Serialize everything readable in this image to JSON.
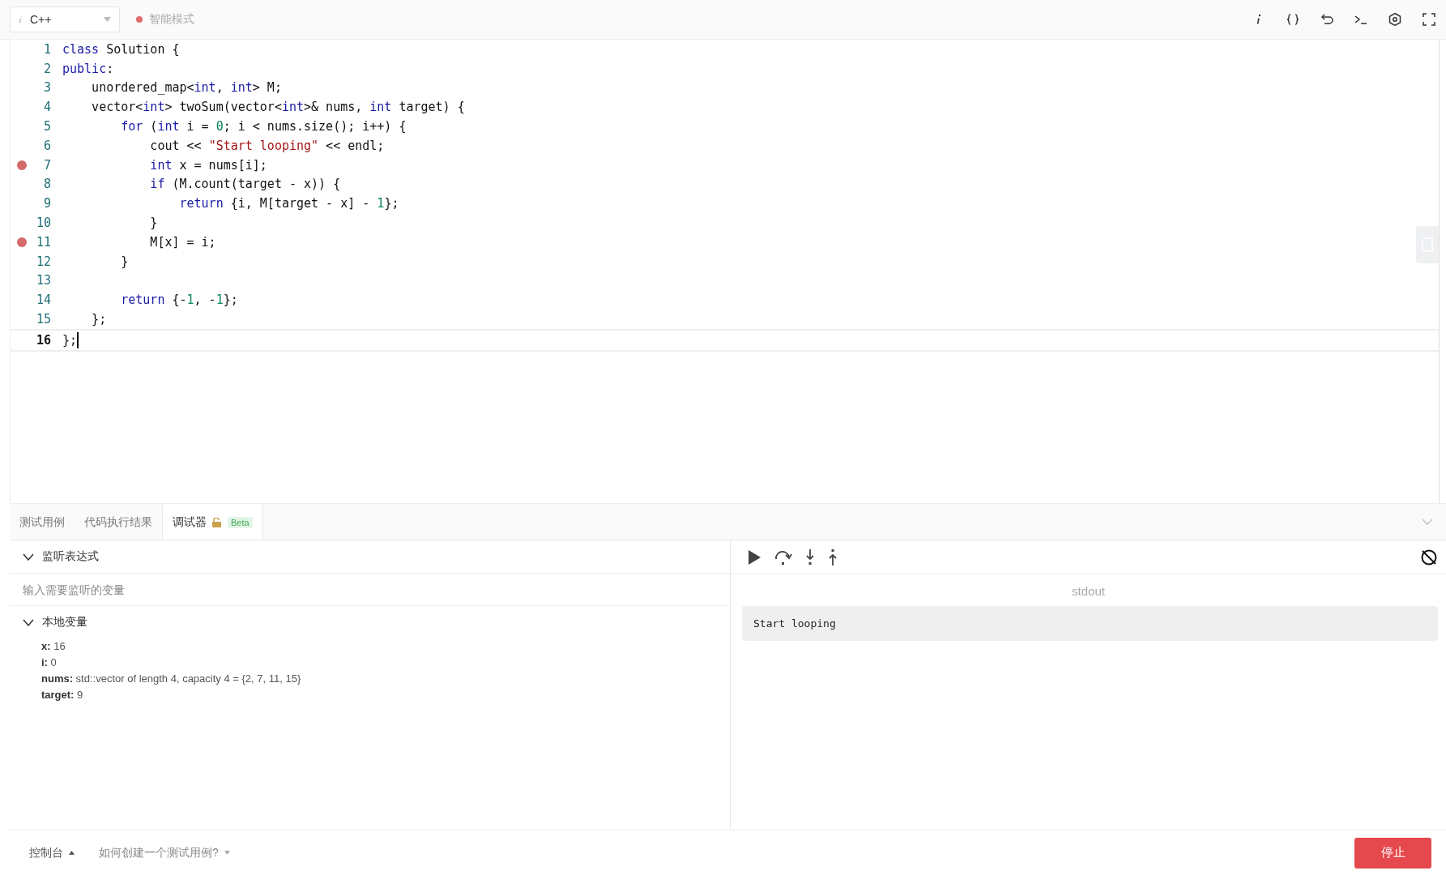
{
  "toolbar": {
    "language": "C++",
    "mode": {
      "label": "智能模式",
      "color": "#e06c6c"
    }
  },
  "editor": {
    "lines": [
      {
        "number": "1",
        "breakpoint": false,
        "current": false,
        "tokens": [
          {
            "kind": "kw",
            "text": "class"
          },
          {
            "kind": "plain",
            "text": " Solution {"
          }
        ]
      },
      {
        "number": "2",
        "breakpoint": false,
        "current": false,
        "tokens": [
          {
            "kind": "kw",
            "text": "public"
          },
          {
            "kind": "plain",
            "text": ":"
          }
        ]
      },
      {
        "number": "3",
        "breakpoint": false,
        "current": false,
        "tokens": [
          {
            "kind": "plain",
            "text": "    unordered_map<"
          },
          {
            "kind": "kw",
            "text": "int"
          },
          {
            "kind": "plain",
            "text": ", "
          },
          {
            "kind": "kw",
            "text": "int"
          },
          {
            "kind": "plain",
            "text": "> M;"
          }
        ]
      },
      {
        "number": "4",
        "breakpoint": false,
        "current": false,
        "tokens": [
          {
            "kind": "plain",
            "text": "    vector<"
          },
          {
            "kind": "kw",
            "text": "int"
          },
          {
            "kind": "plain",
            "text": "> twoSum(vector<"
          },
          {
            "kind": "kw",
            "text": "int"
          },
          {
            "kind": "plain",
            "text": ">& nums, "
          },
          {
            "kind": "kw",
            "text": "int"
          },
          {
            "kind": "plain",
            "text": " target) {"
          }
        ]
      },
      {
        "number": "5",
        "breakpoint": false,
        "current": false,
        "tokens": [
          {
            "kind": "kw",
            "text": "        for"
          },
          {
            "kind": "plain",
            "text": " ("
          },
          {
            "kind": "kw",
            "text": "int"
          },
          {
            "kind": "plain",
            "text": " i = "
          },
          {
            "kind": "num",
            "text": "0"
          },
          {
            "kind": "plain",
            "text": "; i < nums.size(); i++) {"
          }
        ]
      },
      {
        "number": "6",
        "breakpoint": false,
        "current": false,
        "tokens": [
          {
            "kind": "plain",
            "text": "            cout << "
          },
          {
            "kind": "str",
            "text": "\"Start looping\""
          },
          {
            "kind": "plain",
            "text": " << endl;"
          }
        ]
      },
      {
        "number": "7",
        "breakpoint": true,
        "current": false,
        "tokens": [
          {
            "kind": "kw",
            "text": "            int"
          },
          {
            "kind": "plain",
            "text": " x = nums[i];"
          }
        ]
      },
      {
        "number": "8",
        "breakpoint": false,
        "current": false,
        "tokens": [
          {
            "kind": "kw",
            "text": "            if"
          },
          {
            "kind": "plain",
            "text": " (M.count(target - x)) {"
          }
        ]
      },
      {
        "number": "9",
        "breakpoint": false,
        "current": false,
        "tokens": [
          {
            "kind": "kw",
            "text": "                return"
          },
          {
            "kind": "plain",
            "text": " {i, M[target - x] - "
          },
          {
            "kind": "num",
            "text": "1"
          },
          {
            "kind": "plain",
            "text": "};"
          }
        ]
      },
      {
        "number": "10",
        "breakpoint": false,
        "current": false,
        "tokens": [
          {
            "kind": "plain",
            "text": "            }"
          }
        ]
      },
      {
        "number": "11",
        "breakpoint": true,
        "current": false,
        "tokens": [
          {
            "kind": "plain",
            "text": "            M[x] = i;"
          }
        ]
      },
      {
        "number": "12",
        "breakpoint": false,
        "current": false,
        "tokens": [
          {
            "kind": "plain",
            "text": "        }"
          }
        ]
      },
      {
        "number": "13",
        "breakpoint": false,
        "current": false
      },
      {
        "number": "14",
        "breakpoint": false,
        "current": false,
        "tokens": [
          {
            "kind": "kw",
            "text": "        return"
          },
          {
            "kind": "plain",
            "text": " {-"
          },
          {
            "kind": "num",
            "text": "1"
          },
          {
            "kind": "plain",
            "text": ", -"
          },
          {
            "kind": "num",
            "text": "1"
          },
          {
            "kind": "plain",
            "text": "};"
          }
        ]
      },
      {
        "number": "15",
        "breakpoint": false,
        "current": false,
        "tokens": [
          {
            "kind": "plain",
            "text": "    };"
          }
        ]
      },
      {
        "number": "16",
        "breakpoint": false,
        "current": true,
        "tokens": [
          {
            "kind": "plain",
            "text": "};"
          }
        ]
      }
    ]
  },
  "tabs": [
    {
      "label": "测试用例",
      "selected": false
    },
    {
      "label": "代码执行结果",
      "selected": false
    },
    {
      "label": "调试器",
      "selected": true,
      "badge": "Beta"
    }
  ],
  "watch": {
    "title": "监听表达式",
    "expanded": true,
    "placeholder": "输入需要监听的变量"
  },
  "locals": {
    "title": "本地变量",
    "expanded": true,
    "variables": [
      {
        "name": "x:",
        "value": "16"
      },
      {
        "name": "i:",
        "value": "0"
      },
      {
        "name": "nums:",
        "value": "std::vector of length 4, capacity 4 = {2, 7, 11, 15}"
      },
      {
        "name": "target:",
        "value": "9"
      }
    ]
  },
  "output": {
    "label": "stdout",
    "text": "Start looping"
  },
  "footer": {
    "console": "控制台",
    "help": "如何创建一个测试用例?",
    "stop": "停止"
  }
}
